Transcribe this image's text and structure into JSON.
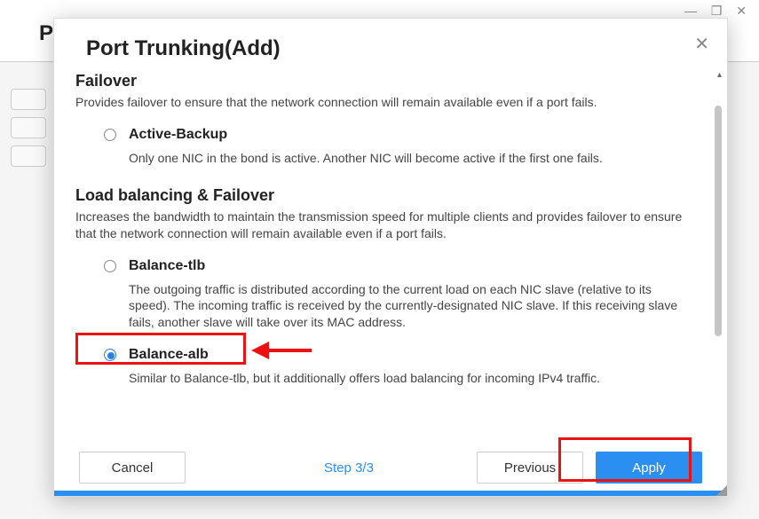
{
  "background": {
    "title": "Port Trunking",
    "window_controls": "—  ❐  ✕"
  },
  "modal": {
    "title": "Port Trunking(Add)",
    "close": "✕"
  },
  "sections": [
    {
      "title": "Failover",
      "desc": "Provides failover to ensure that the network connection will remain available even if a port fails.",
      "options": [
        {
          "label": "Active-Backup",
          "desc": "Only one NIC in the bond is active. Another NIC will become active if the first one fails.",
          "selected": false
        }
      ]
    },
    {
      "title": "Load balancing & Failover",
      "desc": "Increases the bandwidth to maintain the transmission speed for multiple clients and provides failover to ensure that the network connection will remain available even if a port fails.",
      "options": [
        {
          "label": "Balance-tlb",
          "desc": "The outgoing traffic is distributed according to the current load on each NIC slave (relative to its speed). The incoming traffic is received by the currently-designated NIC slave. If this receiving slave fails, another slave will take over its MAC address.",
          "selected": false
        },
        {
          "label": "Balance-alb",
          "desc": "Similar to Balance-tlb, but it additionally offers load balancing for incoming IPv4 traffic.",
          "selected": true
        }
      ]
    }
  ],
  "footer": {
    "cancel": "Cancel",
    "step": "Step 3/3",
    "previous": "Previous",
    "apply": "Apply"
  }
}
